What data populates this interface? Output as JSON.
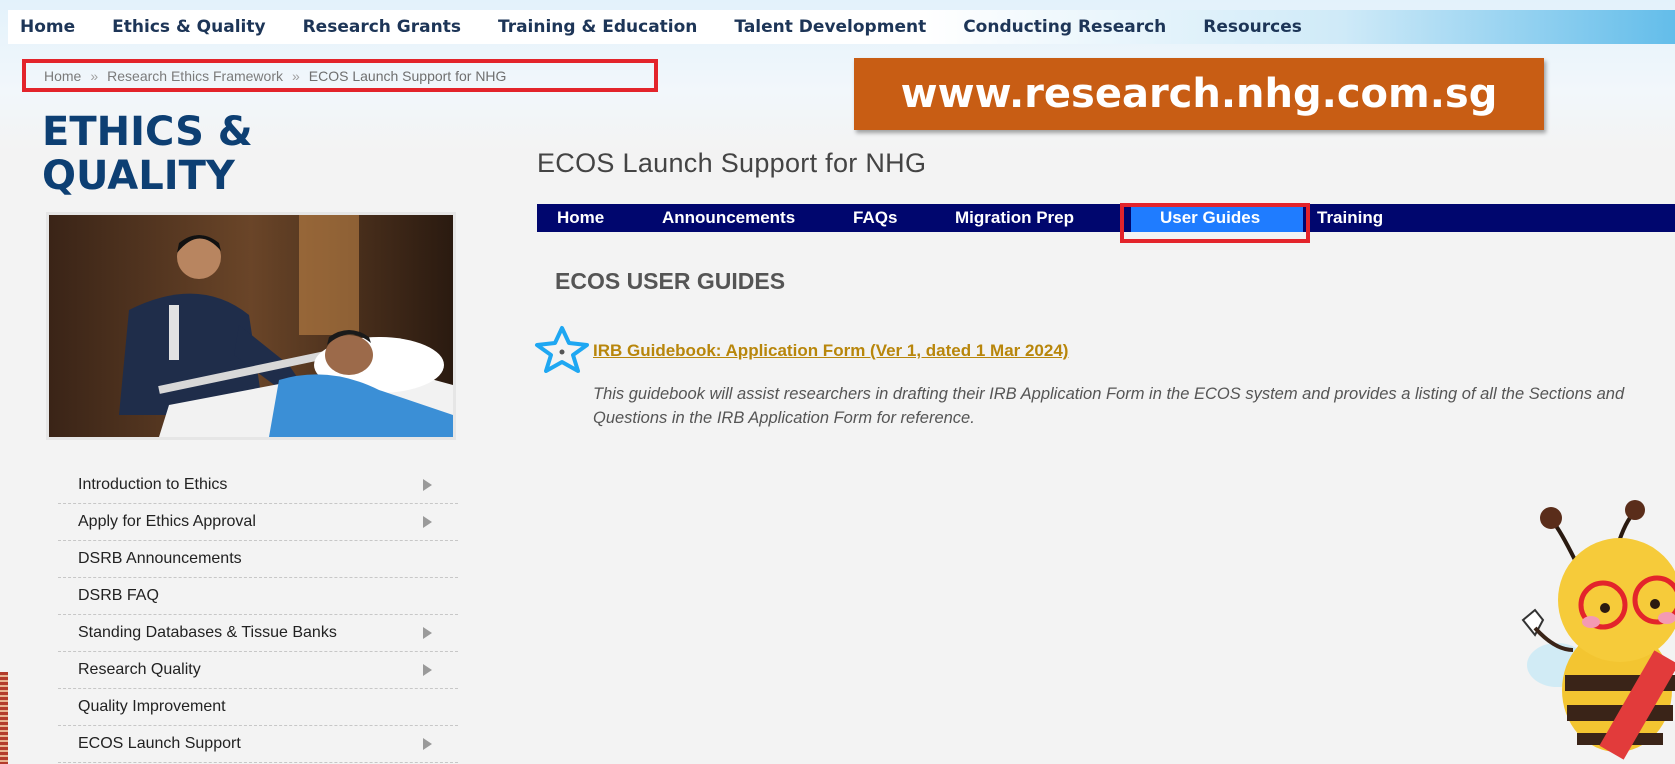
{
  "top_nav": {
    "items": [
      "Home",
      "Ethics & Quality",
      "Research Grants",
      "Training & Education",
      "Talent Development",
      "Conducting Research",
      "Resources"
    ]
  },
  "breadcrumb": {
    "items": [
      "Home",
      "Research Ethics Framework"
    ],
    "separator": "»",
    "current": "ECOS Launch Support for NHG"
  },
  "url_banner": "www.research.nhg.com.sg",
  "section_title": "ETHICS & QUALITY",
  "sidebar": {
    "items": [
      {
        "label": "Introduction to Ethics",
        "has_arrow": true
      },
      {
        "label": "Apply for Ethics Approval",
        "has_arrow": true
      },
      {
        "label": "DSRB Announcements",
        "has_arrow": false
      },
      {
        "label": "DSRB FAQ",
        "has_arrow": false
      },
      {
        "label": "Standing Databases & Tissue Banks",
        "has_arrow": true
      },
      {
        "label": "Research Quality",
        "has_arrow": true
      },
      {
        "label": "Quality Improvement",
        "has_arrow": false
      },
      {
        "label": "ECOS Launch Support",
        "has_arrow": true
      }
    ]
  },
  "page_heading": "ECOS Launch Support for NHG",
  "sub_tabs": {
    "items": [
      "Home",
      "Announcements",
      "FAQs",
      "Migration Prep",
      "User Guides",
      "Training"
    ],
    "active": "User Guides"
  },
  "guides_heading": "ECOS USER GUIDES",
  "guide": {
    "link_text": "IRB Guidebook: Application Form (Ver 1, dated 1 Mar 2024)",
    "description": "This guidebook will assist researchers in drafting their IRB Application Form in the ECOS system and provides a listing of all the Sections and Questions in the IRB Application Form for reference."
  },
  "colors": {
    "top_nav_text": "#1d3557",
    "highlight_red": "#e3242b",
    "banner_orange": "#c85d14",
    "section_title_blue": "#0d3f73",
    "subtab_bar": "#00066e",
    "subtab_active": "#1f7cff",
    "link_gold": "#b8860b",
    "star_blue": "#1ea7f2"
  }
}
